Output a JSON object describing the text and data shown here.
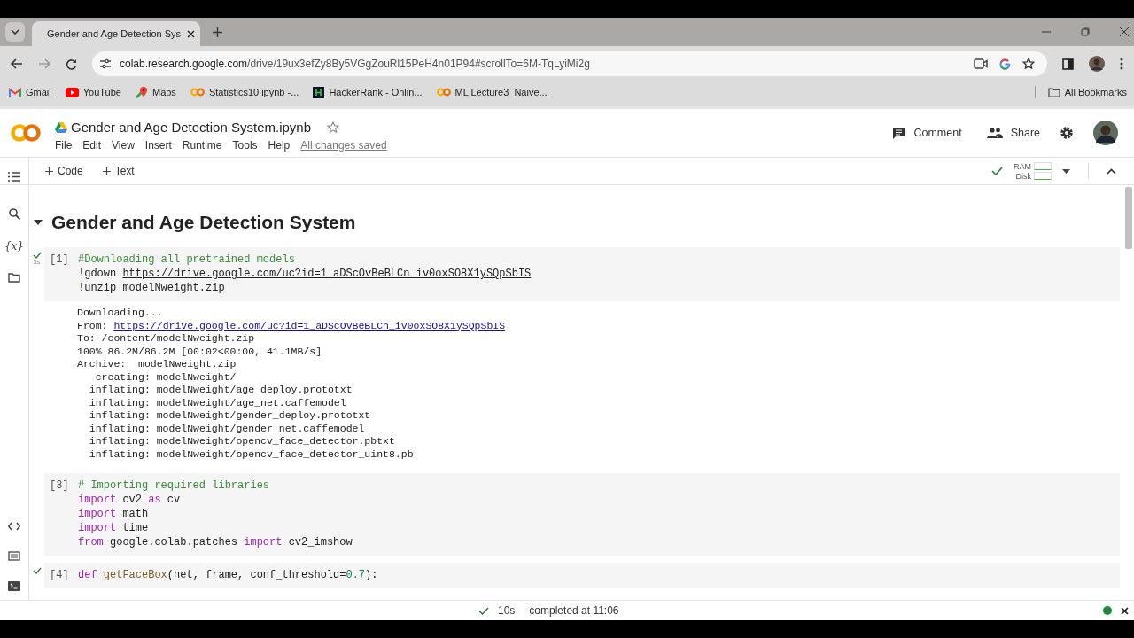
{
  "browser": {
    "tab": {
      "title": "Gender and Age Detection Sys",
      "selected": true
    },
    "url": {
      "host": "colab.research.google.com",
      "path": "/drive/19ux3efZy8By5VGgZouRl15PeH4n01P94#scrollTo=6M-TqLyiMi2g"
    },
    "bookmarks": [
      {
        "kind": "gmail",
        "label": "Gmail"
      },
      {
        "kind": "youtube",
        "label": "YouTube"
      },
      {
        "kind": "maps",
        "label": "Maps"
      },
      {
        "kind": "colab",
        "label": "Statistics10.ipynb -..."
      },
      {
        "kind": "hackerrank",
        "label": "HackerRank - Onlin..."
      },
      {
        "kind": "colab",
        "label": "ML Lecture3_Naive..."
      }
    ],
    "all_bookmarks": "All Bookmarks"
  },
  "notebook": {
    "title": "Gender and Age Detection System.ipynb",
    "menu": [
      "File",
      "Edit",
      "View",
      "Insert",
      "Runtime",
      "Tools",
      "Help"
    ],
    "save_status": "All changes saved",
    "actions": [
      "Comment",
      "Share"
    ],
    "toolbar": [
      "Code",
      "Text"
    ],
    "resources": {
      "connected": true,
      "ram": "RAM",
      "disk": "Disk"
    },
    "variables_label": "{x}",
    "heading": "Gender and Age Detection System",
    "cells": [
      {
        "count": "[1]",
        "completed": true,
        "time": "5s",
        "lines": [
          [
            {
              "kind": "comment",
              "t": "#Downloading all pretrained models"
            }
          ],
          [
            {
              "kind": "op",
              "t": "!"
            },
            {
              "kind": "plain",
              "t": "gdown "
            },
            {
              "kind": "link",
              "t": "https://drive.google.com/uc?id=1_aDScOvBeBLCn_iv0oxSO8X1ySQpSbIS"
            }
          ],
          [
            {
              "kind": "op",
              "t": "!"
            },
            {
              "kind": "plain",
              "t": "unzip modelNweight.zip"
            }
          ]
        ],
        "output": [
          [
            {
              "kind": "plain",
              "t": "Downloading..."
            }
          ],
          [
            {
              "kind": "plain",
              "t": "From: "
            },
            {
              "kind": "outlink",
              "t": "https://drive.google.com/uc?id=1_aDScOvBeBLCn_iv0oxSO8X1ySQpSbIS"
            }
          ],
          [
            {
              "kind": "plain",
              "t": "To: /content/modelNweight.zip"
            }
          ],
          [
            {
              "kind": "plain",
              "t": "100% 86.2M/86.2M [00:02<00:00, 41.1MB/s]"
            }
          ],
          [
            {
              "kind": "plain",
              "t": "Archive:  modelNweight.zip"
            }
          ],
          [
            {
              "kind": "plain",
              "t": "   creating: modelNweight/"
            }
          ],
          [
            {
              "kind": "plain",
              "t": "  inflating: modelNweight/age_deploy.prototxt"
            }
          ],
          [
            {
              "kind": "plain",
              "t": "  inflating: modelNweight/age_net.caffemodel"
            }
          ],
          [
            {
              "kind": "plain",
              "t": "  inflating: modelNweight/gender_deploy.prototxt"
            }
          ],
          [
            {
              "kind": "plain",
              "t": "  inflating: modelNweight/gender_net.caffemodel"
            }
          ],
          [
            {
              "kind": "plain",
              "t": "  inflating: modelNweight/opencv_face_detector.pbtxt"
            }
          ],
          [
            {
              "kind": "plain",
              "t": "  inflating: modelNweight/opencv_face_detector_uint8.pb"
            }
          ]
        ]
      },
      {
        "count": "[3]",
        "completed": false,
        "lines": [
          [
            {
              "kind": "comment",
              "t": "# Importing required libraries"
            }
          ],
          [
            {
              "kind": "kw",
              "t": "import"
            },
            {
              "kind": "plain",
              "t": " cv2 "
            },
            {
              "kind": "kw",
              "t": "as"
            },
            {
              "kind": "plain",
              "t": " cv"
            }
          ],
          [
            {
              "kind": "kw",
              "t": "import"
            },
            {
              "kind": "plain",
              "t": " math"
            }
          ],
          [
            {
              "kind": "kw",
              "t": "import"
            },
            {
              "kind": "plain",
              "t": " time"
            }
          ],
          [
            {
              "kind": "kw",
              "t": "from"
            },
            {
              "kind": "plain",
              "t": " google.colab.patches "
            },
            {
              "kind": "kw",
              "t": "import"
            },
            {
              "kind": "plain",
              "t": " cv2_imshow"
            }
          ]
        ]
      },
      {
        "count": "[4]",
        "completed": true,
        "lines": [
          [
            {
              "kind": "kw",
              "t": "def"
            },
            {
              "kind": "fn",
              "t": " getFaceBox"
            },
            {
              "kind": "plain",
              "t": "(net, frame, conf_threshold="
            },
            {
              "kind": "num",
              "t": "0.7"
            },
            {
              "kind": "plain",
              "t": "):"
            }
          ]
        ]
      }
    ]
  },
  "status_bar": {
    "completed": true,
    "duration": "10s",
    "message": "completed at 11:06"
  }
}
